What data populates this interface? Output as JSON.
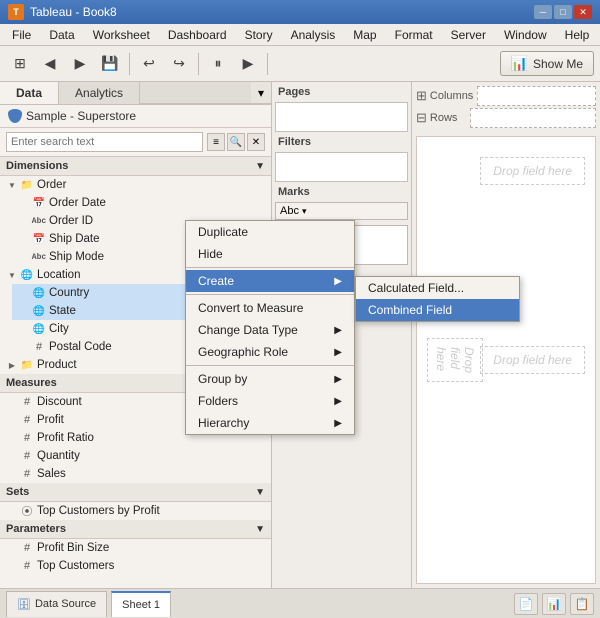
{
  "titlebar": {
    "title": "Tableau - Book8",
    "minimize_label": "─",
    "maximize_label": "□",
    "close_label": "✕"
  },
  "menubar": {
    "items": [
      "File",
      "Data",
      "Worksheet",
      "Dashboard",
      "Story",
      "Analysis",
      "Map",
      "Format",
      "Server",
      "Window",
      "Help"
    ]
  },
  "toolbar": {
    "show_me_label": "Show Me"
  },
  "left_panel": {
    "tabs": [
      "Data",
      "Analytics"
    ],
    "data_source": "Sample - Superstore",
    "search_placeholder": "Enter search text",
    "dimensions_label": "Dimensions",
    "tree": {
      "order_group": "Order",
      "order_date": "Order Date",
      "order_id": "Order ID",
      "ship_date": "Ship Date",
      "ship_mode": "Ship Mode",
      "location_group": "Location",
      "country": "Country",
      "state": "State",
      "city": "City",
      "postal_code": "Postal Code",
      "product_group": "Product"
    },
    "measures_label": "Measures",
    "measures": {
      "discount": "Discount",
      "profit": "Profit",
      "profit_ratio": "Profit Ratio",
      "quantity": "Quantity",
      "sales": "Sales"
    },
    "sets_label": "Sets",
    "sets": {
      "top_customers": "Top Customers by Profit"
    },
    "parameters_label": "Parameters",
    "parameters": {
      "profit_bin_size": "Profit Bin Size",
      "top_customers": "Top Customers"
    },
    "data_analytics_title": "Data Analytics Sample Superstore"
  },
  "context_menu": {
    "items": [
      {
        "label": "Duplicate",
        "has_submenu": false
      },
      {
        "label": "Hide",
        "has_submenu": false
      },
      {
        "label": "Create",
        "has_submenu": true
      },
      {
        "label": "Convert to Measure",
        "has_submenu": false
      },
      {
        "label": "Change Data Type",
        "has_submenu": true
      },
      {
        "label": "Geographic Role",
        "has_submenu": true
      },
      {
        "label": "Group by",
        "has_submenu": true
      },
      {
        "label": "Folders",
        "has_submenu": true
      },
      {
        "label": "Hierarchy",
        "has_submenu": true
      }
    ]
  },
  "submenu": {
    "items": [
      {
        "label": "Calculated Field...",
        "active": false
      },
      {
        "label": "Combined Field",
        "active": true
      }
    ]
  },
  "worksheet": {
    "columns_label": "Columns",
    "rows_label": "Rows",
    "pages_label": "Pages",
    "filters_label": "Filters",
    "marks_label": "Marks",
    "marks_type": "Abc",
    "drop_field_here": "Drop field here",
    "drop_field_here2": "Drop field here"
  },
  "status_bar": {
    "data_source_label": "Data Source",
    "sheet_label": "Sheet 1"
  }
}
